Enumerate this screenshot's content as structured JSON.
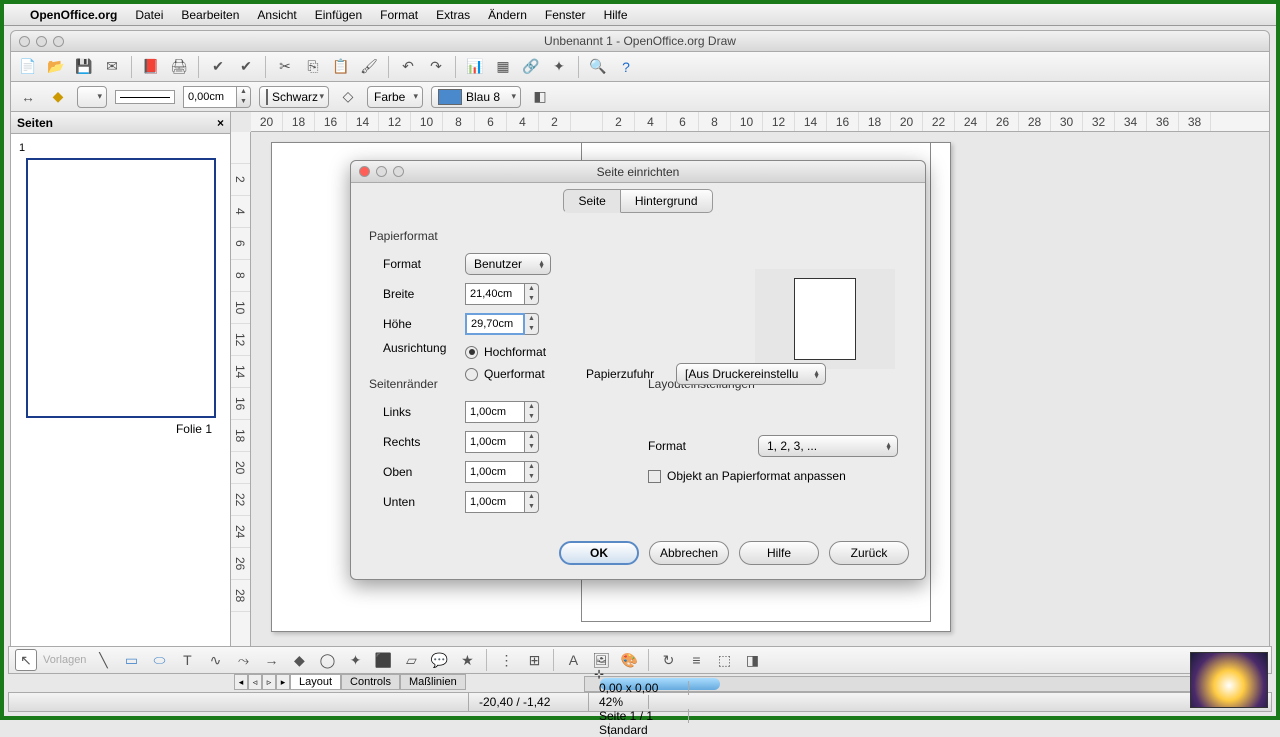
{
  "menubar": {
    "app": "OpenOffice.org",
    "items": [
      "Datei",
      "Bearbeiten",
      "Ansicht",
      "Einfügen",
      "Format",
      "Extras",
      "Ändern",
      "Fenster",
      "Hilfe"
    ]
  },
  "window": {
    "title": "Unbenannt 1 - OpenOffice.org Draw"
  },
  "toolbar2": {
    "line_width": "0,00cm",
    "line_color": "Schwarz",
    "fill_type": "Farbe",
    "fill_color": "Blau 8"
  },
  "side_panel": {
    "title": "Seiten",
    "page_num": "1",
    "thumb_label": "Folie 1"
  },
  "ruler_h": [
    "20",
    "18",
    "16",
    "14",
    "12",
    "10",
    "8",
    "6",
    "4",
    "2",
    "",
    "2",
    "4",
    "6",
    "8",
    "10",
    "12",
    "14",
    "16",
    "18",
    "20",
    "22",
    "24",
    "26",
    "28",
    "30",
    "32",
    "34",
    "36",
    "38"
  ],
  "ruler_v": [
    "",
    "2",
    "4",
    "6",
    "8",
    "10",
    "12",
    "14",
    "16",
    "18",
    "20",
    "22",
    "24",
    "26",
    "28"
  ],
  "dialog": {
    "title": "Seite einrichten",
    "tabs": [
      "Seite",
      "Hintergrund"
    ],
    "paper_format_group": "Papierformat",
    "format_label": "Format",
    "format_value": "Benutzer",
    "width_label": "Breite",
    "width_value": "21,40cm",
    "height_label": "Höhe",
    "height_value": "29,70cm",
    "orientation_label": "Ausrichtung",
    "orientation_portrait": "Hochformat",
    "orientation_landscape": "Querformat",
    "paper_tray_label": "Papierzufuhr",
    "paper_tray_value": "[Aus Druckereinstellu",
    "margins_group": "Seitenränder",
    "layout_group": "Layouteinstellungen",
    "margin_left_label": "Links",
    "margin_left_value": "1,00cm",
    "margin_right_label": "Rechts",
    "margin_right_value": "1,00cm",
    "margin_top_label": "Oben",
    "margin_top_value": "1,00cm",
    "margin_bottom_label": "Unten",
    "margin_bottom_value": "1,00cm",
    "layout_format_label": "Format",
    "layout_format_value": "1, 2, 3, ...",
    "fit_object_label": "Objekt an Papierformat anpassen",
    "btn_ok": "OK",
    "btn_cancel": "Abbrechen",
    "btn_help": "Hilfe",
    "btn_back": "Zurück"
  },
  "bottom_tabs": [
    "Layout",
    "Controls",
    "Maßlinien"
  ],
  "statusbar": {
    "coords": "-20,40 / -1,42",
    "size": "0,00 x 0,00",
    "zoom": "42%",
    "page": "Seite 1 / 1",
    "template": "Standard"
  },
  "bottom_toolbar_hint": "Vorlagen"
}
